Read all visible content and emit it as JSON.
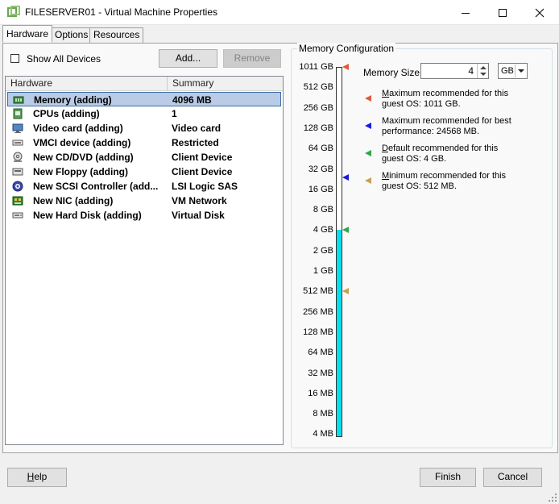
{
  "window": {
    "title": "FILESERVER01 - Virtual Machine Properties"
  },
  "tabs": [
    {
      "label": "Hardware",
      "active": true
    },
    {
      "label": "Options",
      "active": false
    },
    {
      "label": "Resources",
      "active": false
    }
  ],
  "toolbar": {
    "show_all_devices": "Show All Devices",
    "show_all_devices_checked": false,
    "add_label": "Add...",
    "remove_label": "Remove"
  },
  "hardware": {
    "columns": [
      "Hardware",
      "Summary"
    ],
    "rows": [
      {
        "name": "Memory (adding)",
        "summary": "4096 MB",
        "icon": "memory-icon",
        "selected": true
      },
      {
        "name": "CPUs (adding)",
        "summary": "1",
        "icon": "cpu-icon"
      },
      {
        "name": "Video card  (adding)",
        "summary": "Video card",
        "icon": "monitor-icon"
      },
      {
        "name": "VMCI device (adding)",
        "summary": "Restricted",
        "icon": "vmci-device-icon"
      },
      {
        "name": "New CD/DVD (adding)",
        "summary": "Client Device",
        "icon": "cd-dvd-icon"
      },
      {
        "name": "New Floppy (adding)",
        "summary": "Client Device",
        "icon": "floppy-icon"
      },
      {
        "name": "New SCSI Controller (add...",
        "summary": "LSI Logic SAS",
        "icon": "scsi-controller-icon"
      },
      {
        "name": "New NIC (adding)",
        "summary": "VM Network",
        "icon": "network-card-icon"
      },
      {
        "name": "New Hard Disk (adding)",
        "summary": "Virtual Disk",
        "icon": "hard-disk-icon"
      }
    ]
  },
  "memory": {
    "group_label": "Memory Configuration",
    "size_label": "Memory Size:",
    "size_value": "4",
    "unit": "GB",
    "scale": [
      "1011 GB",
      "512 GB",
      "256 GB",
      "128 GB",
      "64 GB",
      "32 GB",
      "16 GB",
      "8 GB",
      "4 GB",
      "2 GB",
      "1 GB",
      "512 MB",
      "256 MB",
      "128 MB",
      "64 MB",
      "32 MB",
      "16 MB",
      "8 MB",
      "4 MB"
    ],
    "current_scale_index": 8,
    "legend": [
      {
        "line1": "Maximum recommended for this",
        "line2": "guest OS: 1011 GB.",
        "color": "#e05a3a",
        "scale_index": 0,
        "accel": "M",
        "rest": "aximum recommended for this"
      },
      {
        "line1": "Maximum recommended for best",
        "line2": "performance: 24568 MB.",
        "color": "#1a1adc",
        "scale_index": 5.4,
        "accel": "",
        "rest": "Maximum recommended for best"
      },
      {
        "line1": "Default recommended for this",
        "line2": "guest OS: 4 GB.",
        "color": "#2fa84a",
        "scale_index": 8,
        "accel": "D",
        "rest": "efault recommended for this"
      },
      {
        "line1": "Minimum recommended for this",
        "line2": "guest OS: 512 MB.",
        "color": "#c8a050",
        "scale_index": 11,
        "accel": "M",
        "rest": "inimum recommended for this"
      }
    ]
  },
  "footer": {
    "help_accel": "H",
    "help_rest": "elp",
    "finish_label": "Finish",
    "cancel_label": "Cancel"
  }
}
